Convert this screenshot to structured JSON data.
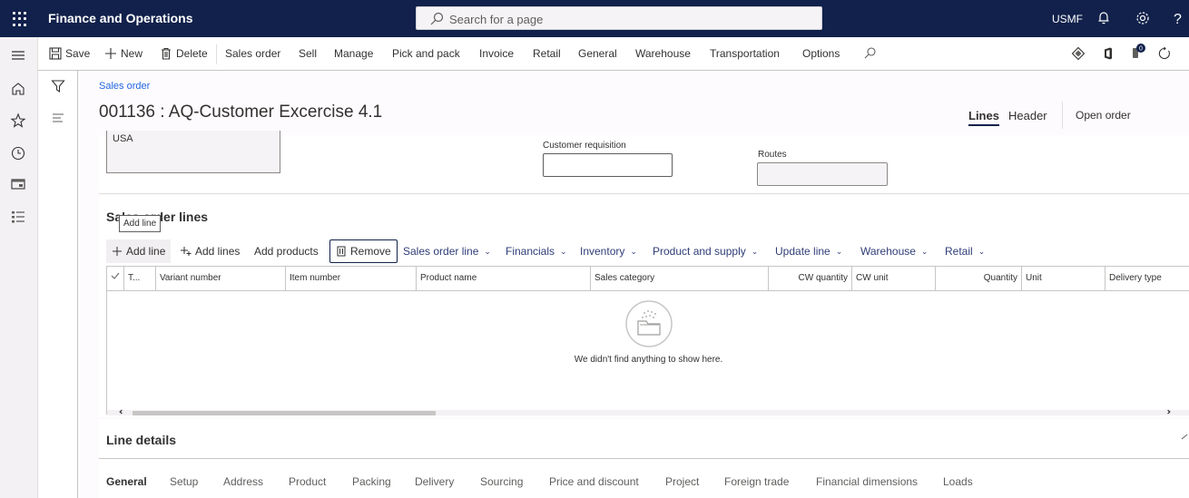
{
  "topbar": {
    "app_title": "Finance and Operations",
    "search_placeholder": "Search for a page",
    "company": "USMF"
  },
  "action_pane": {
    "save": "Save",
    "new": "New",
    "delete": "Delete",
    "tabs": [
      "Sales order",
      "Sell",
      "Manage",
      "Pick and pack",
      "Invoice",
      "Retail",
      "General",
      "Warehouse",
      "Transportation",
      "Options"
    ],
    "notification_count": "0"
  },
  "header": {
    "breadcrumb": "Sales order",
    "title": "001136 : AQ-Customer Excercise 4.1",
    "view_tabs": {
      "lines": "Lines",
      "header": "Header"
    },
    "status": "Open order"
  },
  "fields": {
    "address_value": "USA",
    "customer_requisition_label": "Customer requisition",
    "customer_requisition_value": "",
    "routes_label": "Routes",
    "routes_value": ""
  },
  "sales_order_lines": {
    "title": "Sales order lines",
    "tooltip": "Add line",
    "toolbar": {
      "add_line": "Add line",
      "add_lines": "Add lines",
      "add_products": "Add products",
      "remove": "Remove",
      "menus": [
        "Sales order line",
        "Financials",
        "Inventory",
        "Product and supply",
        "Update line",
        "Warehouse",
        "Retail"
      ]
    },
    "columns": [
      "T...",
      "Variant number",
      "Item number",
      "Product name",
      "Sales category",
      "CW quantity",
      "CW unit",
      "Quantity",
      "Unit",
      "Delivery type"
    ],
    "rows": [],
    "empty_message": "We didn't find anything to show here."
  },
  "line_details": {
    "title": "Line details",
    "tabs": [
      "General",
      "Setup",
      "Address",
      "Product",
      "Packing",
      "Delivery",
      "Sourcing",
      "Price and discount",
      "Project",
      "Foreign trade",
      "Financial dimensions",
      "Loads"
    ],
    "active_tab": "General"
  }
}
